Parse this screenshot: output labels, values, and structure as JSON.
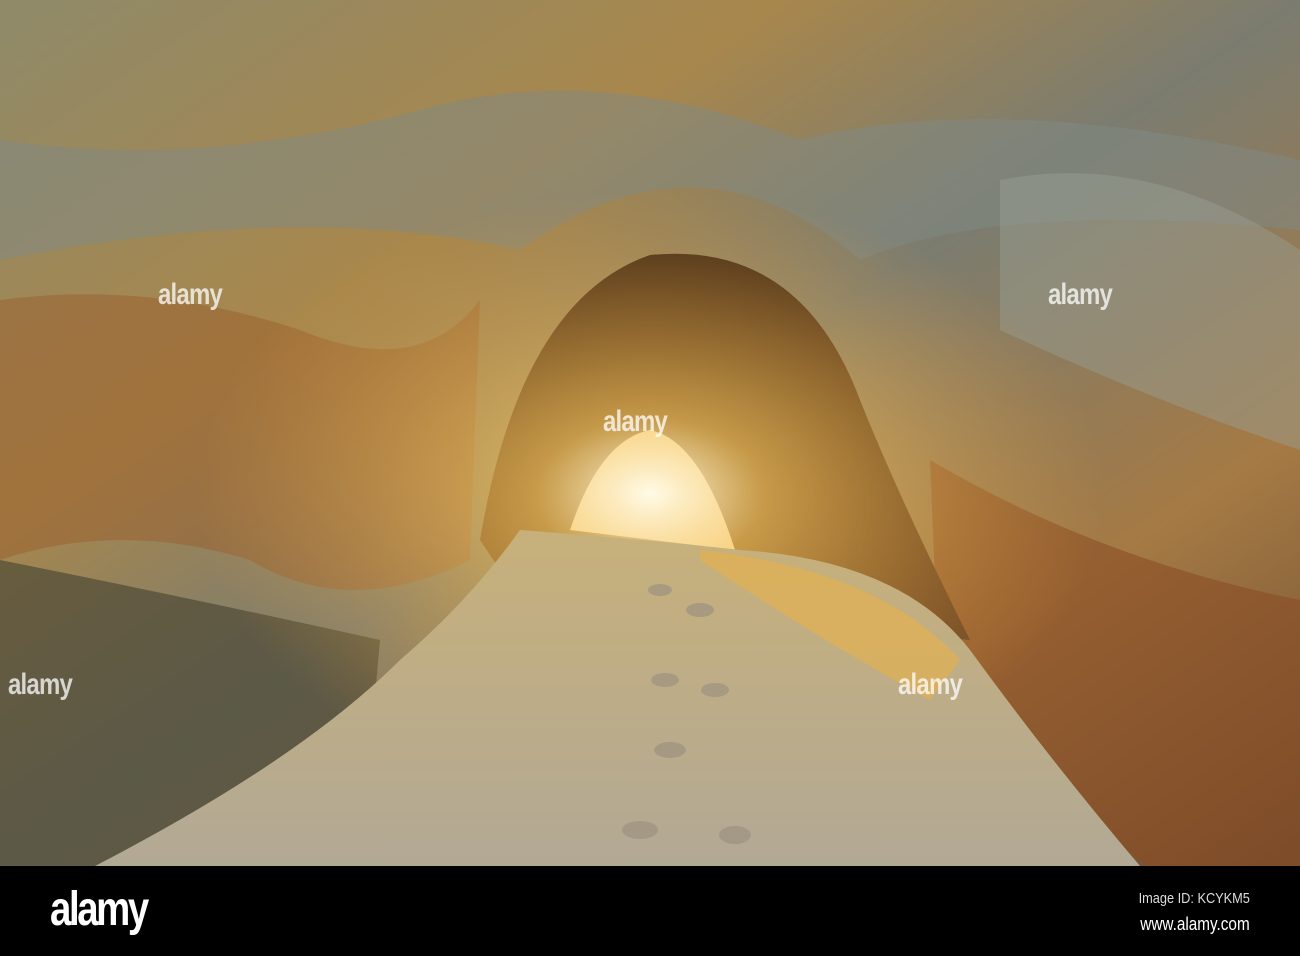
{
  "photo": {
    "subject": "sea cave tunnel with sandy floor",
    "colors": {
      "rock_ochre": "#b08a4a",
      "rock_blue": "#6e7d82",
      "rock_rust": "#9a4e22",
      "sand": "#b5a88f",
      "light": "#fff8e0"
    }
  },
  "watermark": {
    "text": "alamy"
  },
  "footer": {
    "logo": "alamy",
    "image_id": "Image ID: KCYKM5",
    "url": "www.alamy.com"
  }
}
